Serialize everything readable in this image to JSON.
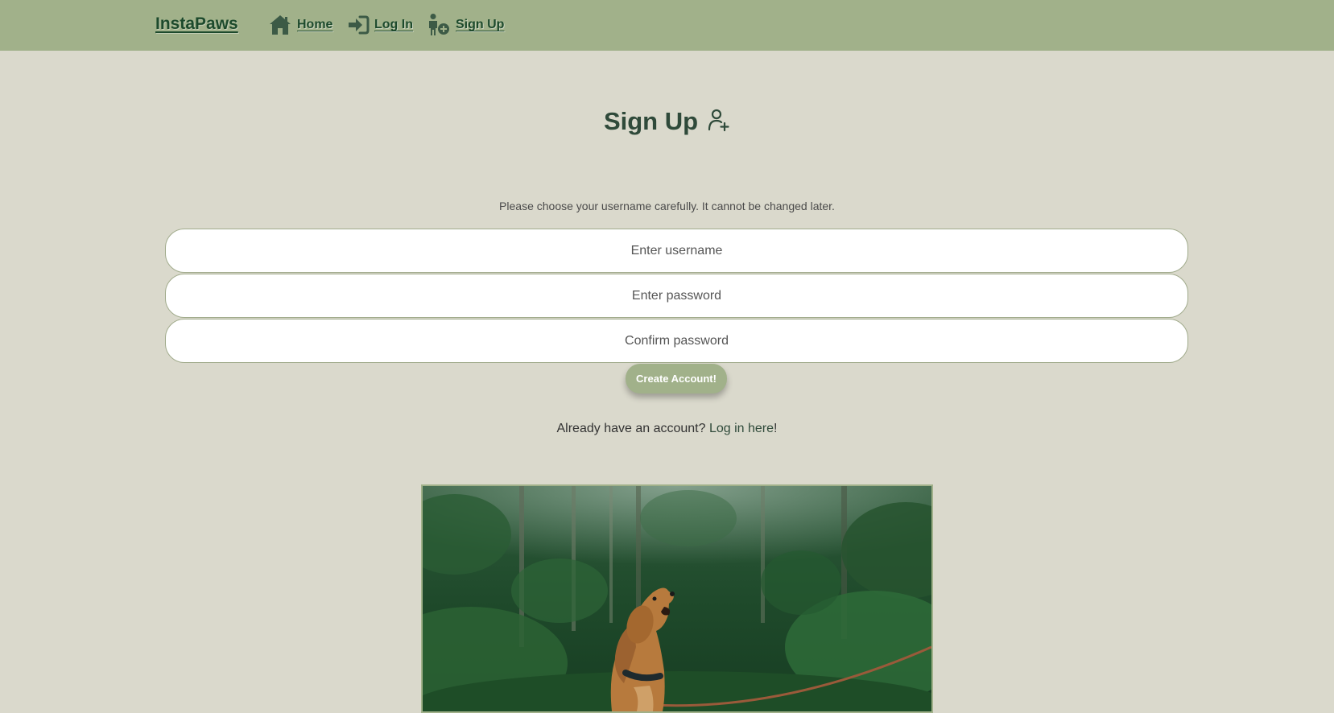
{
  "navbar": {
    "brand": "InstaPaws",
    "links": [
      {
        "label": "Home",
        "icon": "home-icon"
      },
      {
        "label": "Log In",
        "icon": "login-icon"
      },
      {
        "label": "Sign Up",
        "icon": "add-person-icon"
      }
    ],
    "colors": {
      "bar": "#a1b18a",
      "link": "#1d4a2c"
    }
  },
  "page": {
    "title": "Sign Up",
    "title_icon": "user-plus-icon",
    "hint": "Please choose your username carefully. It cannot be changed later."
  },
  "form": {
    "username_placeholder": "Enter username",
    "password_placeholder": "Enter password",
    "confirm_placeholder": "Confirm password",
    "submit_label": "Create Account!"
  },
  "footer": {
    "prefix": "Already have an account? ",
    "link": "Log in here",
    "suffix": "!"
  },
  "image": {
    "subject": "dog-in-forest-photo"
  },
  "colors": {
    "background": "#dad9cc",
    "accent": "#a1b18a",
    "heading": "#2f4a3a"
  }
}
